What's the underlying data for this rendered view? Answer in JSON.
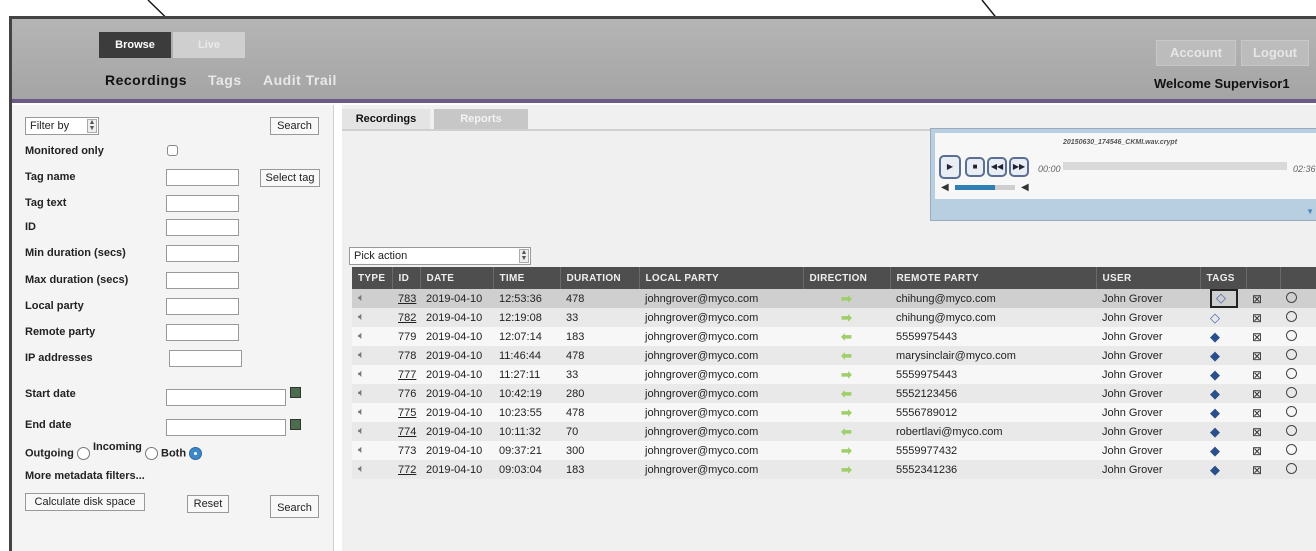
{
  "header": {
    "modes": {
      "browse": "Browse",
      "live": "Live"
    },
    "nav": {
      "recordings": "Recordings",
      "tags": "Tags",
      "audit_trail": "Audit Trail"
    },
    "account_label": "Account",
    "logout_label": "Logout",
    "welcome": "Welcome Supervisor1"
  },
  "filters": {
    "filter_by": "Filter by",
    "search_top": "Search",
    "monitored_only": "Monitored only",
    "tag_name": "Tag name",
    "select_tag": "Select tag",
    "tag_text": "Tag text",
    "id": "ID",
    "min_duration": "Min duration (secs)",
    "max_duration": "Max duration (secs)",
    "local_party": "Local party",
    "remote_party": "Remote party",
    "ip_addresses": "IP addresses",
    "start_date": "Start date",
    "end_date": "End date",
    "outgoing": "Outgoing",
    "incoming": "Incoming",
    "both": "Both",
    "more_filters": "More metadata filters...",
    "calc_disk": "Calculate disk space",
    "reset": "Reset",
    "search_bottom": "Search"
  },
  "content_tabs": {
    "recordings": "Recordings",
    "reports": "Reports"
  },
  "player": {
    "file": "20150630_174546_CKMI.wav.crypt",
    "time_start": "00:00",
    "time_end": "02:36",
    "volume_level": 0.67
  },
  "action": {
    "placeholder": "Pick action"
  },
  "table": {
    "columns": [
      "TYPE",
      "ID",
      "DATE",
      "TIME",
      "DURATION",
      "LOCAL PARTY",
      "DIRECTION",
      "REMOTE PARTY",
      "USER",
      "TAGS",
      "",
      ""
    ],
    "rows": [
      {
        "id": "783",
        "date": "2019-04-10",
        "time": "12:53:36",
        "duration": "478",
        "local": "johngrover@myco.com",
        "direction": "out",
        "remote": "chihung@myco.com",
        "user": "John Grover",
        "tag": "outline"
      },
      {
        "id": "782",
        "date": "2019-04-10",
        "time": "12:19:08",
        "duration": "33",
        "local": "johngrover@myco.com",
        "direction": "out",
        "remote": "chihung@myco.com",
        "user": "John Grover",
        "tag": "outline"
      },
      {
        "id": "779",
        "date": "2019-04-10",
        "time": "12:07:14",
        "duration": "183",
        "local": "johngrover@myco.com",
        "direction": "in",
        "remote": "5559975443",
        "user": "John Grover",
        "tag": "filled"
      },
      {
        "id": "778",
        "date": "2019-04-10",
        "time": "11:46:44",
        "duration": "478",
        "local": "johngrover@myco.com",
        "direction": "in",
        "remote": "marysinclair@myco.com",
        "user": "John Grover",
        "tag": "filled"
      },
      {
        "id": "777",
        "date": "2019-04-10",
        "time": "11:27:11",
        "duration": "33",
        "local": "johngrover@myco.com",
        "direction": "out",
        "remote": "5559975443",
        "user": "John Grover",
        "tag": "filled"
      },
      {
        "id": "776",
        "date": "2019-04-10",
        "time": "10:42:19",
        "duration": "280",
        "local": "johngrover@myco.com",
        "direction": "in",
        "remote": "5552123456",
        "user": "John Grover",
        "tag": "filled"
      },
      {
        "id": "775",
        "date": "2019-04-10",
        "time": "10:23:55",
        "duration": "478",
        "local": "johngrover@myco.com",
        "direction": "out",
        "remote": "5556789012",
        "user": "John Grover",
        "tag": "filled"
      },
      {
        "id": "774",
        "date": "2019-04-10",
        "time": "10:11:32",
        "duration": "70",
        "local": "johngrover@myco.com",
        "direction": "in",
        "remote": "robertlavi@myco.com",
        "user": "John Grover",
        "tag": "filled"
      },
      {
        "id": "773",
        "date": "2019-04-10",
        "time": "09:37:21",
        "duration": "300",
        "local": "johngrover@myco.com",
        "direction": "out",
        "remote": "5559977432",
        "user": "John Grover",
        "tag": "filled"
      },
      {
        "id": "772",
        "date": "2019-04-10",
        "time": "09:03:04",
        "duration": "183",
        "local": "johngrover@myco.com",
        "direction": "out",
        "remote": "5552341236",
        "user": "John Grover",
        "tag": "filled"
      }
    ]
  }
}
